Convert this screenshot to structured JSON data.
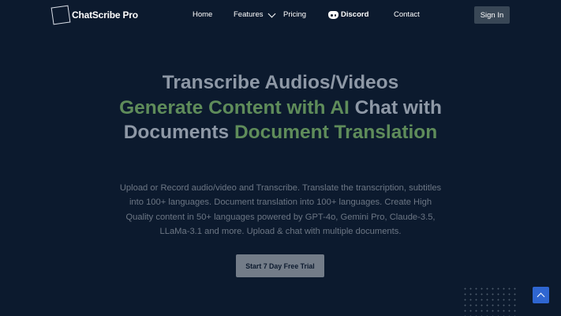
{
  "brand": {
    "name": "ChatScribe Pro"
  },
  "nav": {
    "home": "Home",
    "features": "Features",
    "pricing": "Pricing",
    "discord": "Discord",
    "contact": "Contact",
    "signin": "Sign In"
  },
  "hero": {
    "line1": "Transcribe Audios/Videos",
    "highlight1": "Generate Content with AI",
    "text2": " Chat with Documents ",
    "highlight2": "Document Translation"
  },
  "subtitle": "Upload or Record audio/video and Transcribe. Translate the transcription, subtitles into 100+ languages. Document translation into 100+ languages. Create High Quality content in 50+ languages powered by GPT-4o, Gemini Pro, Claude-3.5, LLaMa-3.1 and more. Upload & chat with multiple documents.",
  "cta": {
    "label": "Start 7 Day Free Trial"
  },
  "colors": {
    "background": "#0c1a2e",
    "highlight": "#5f8c5a",
    "accent": "#2f66d1"
  }
}
